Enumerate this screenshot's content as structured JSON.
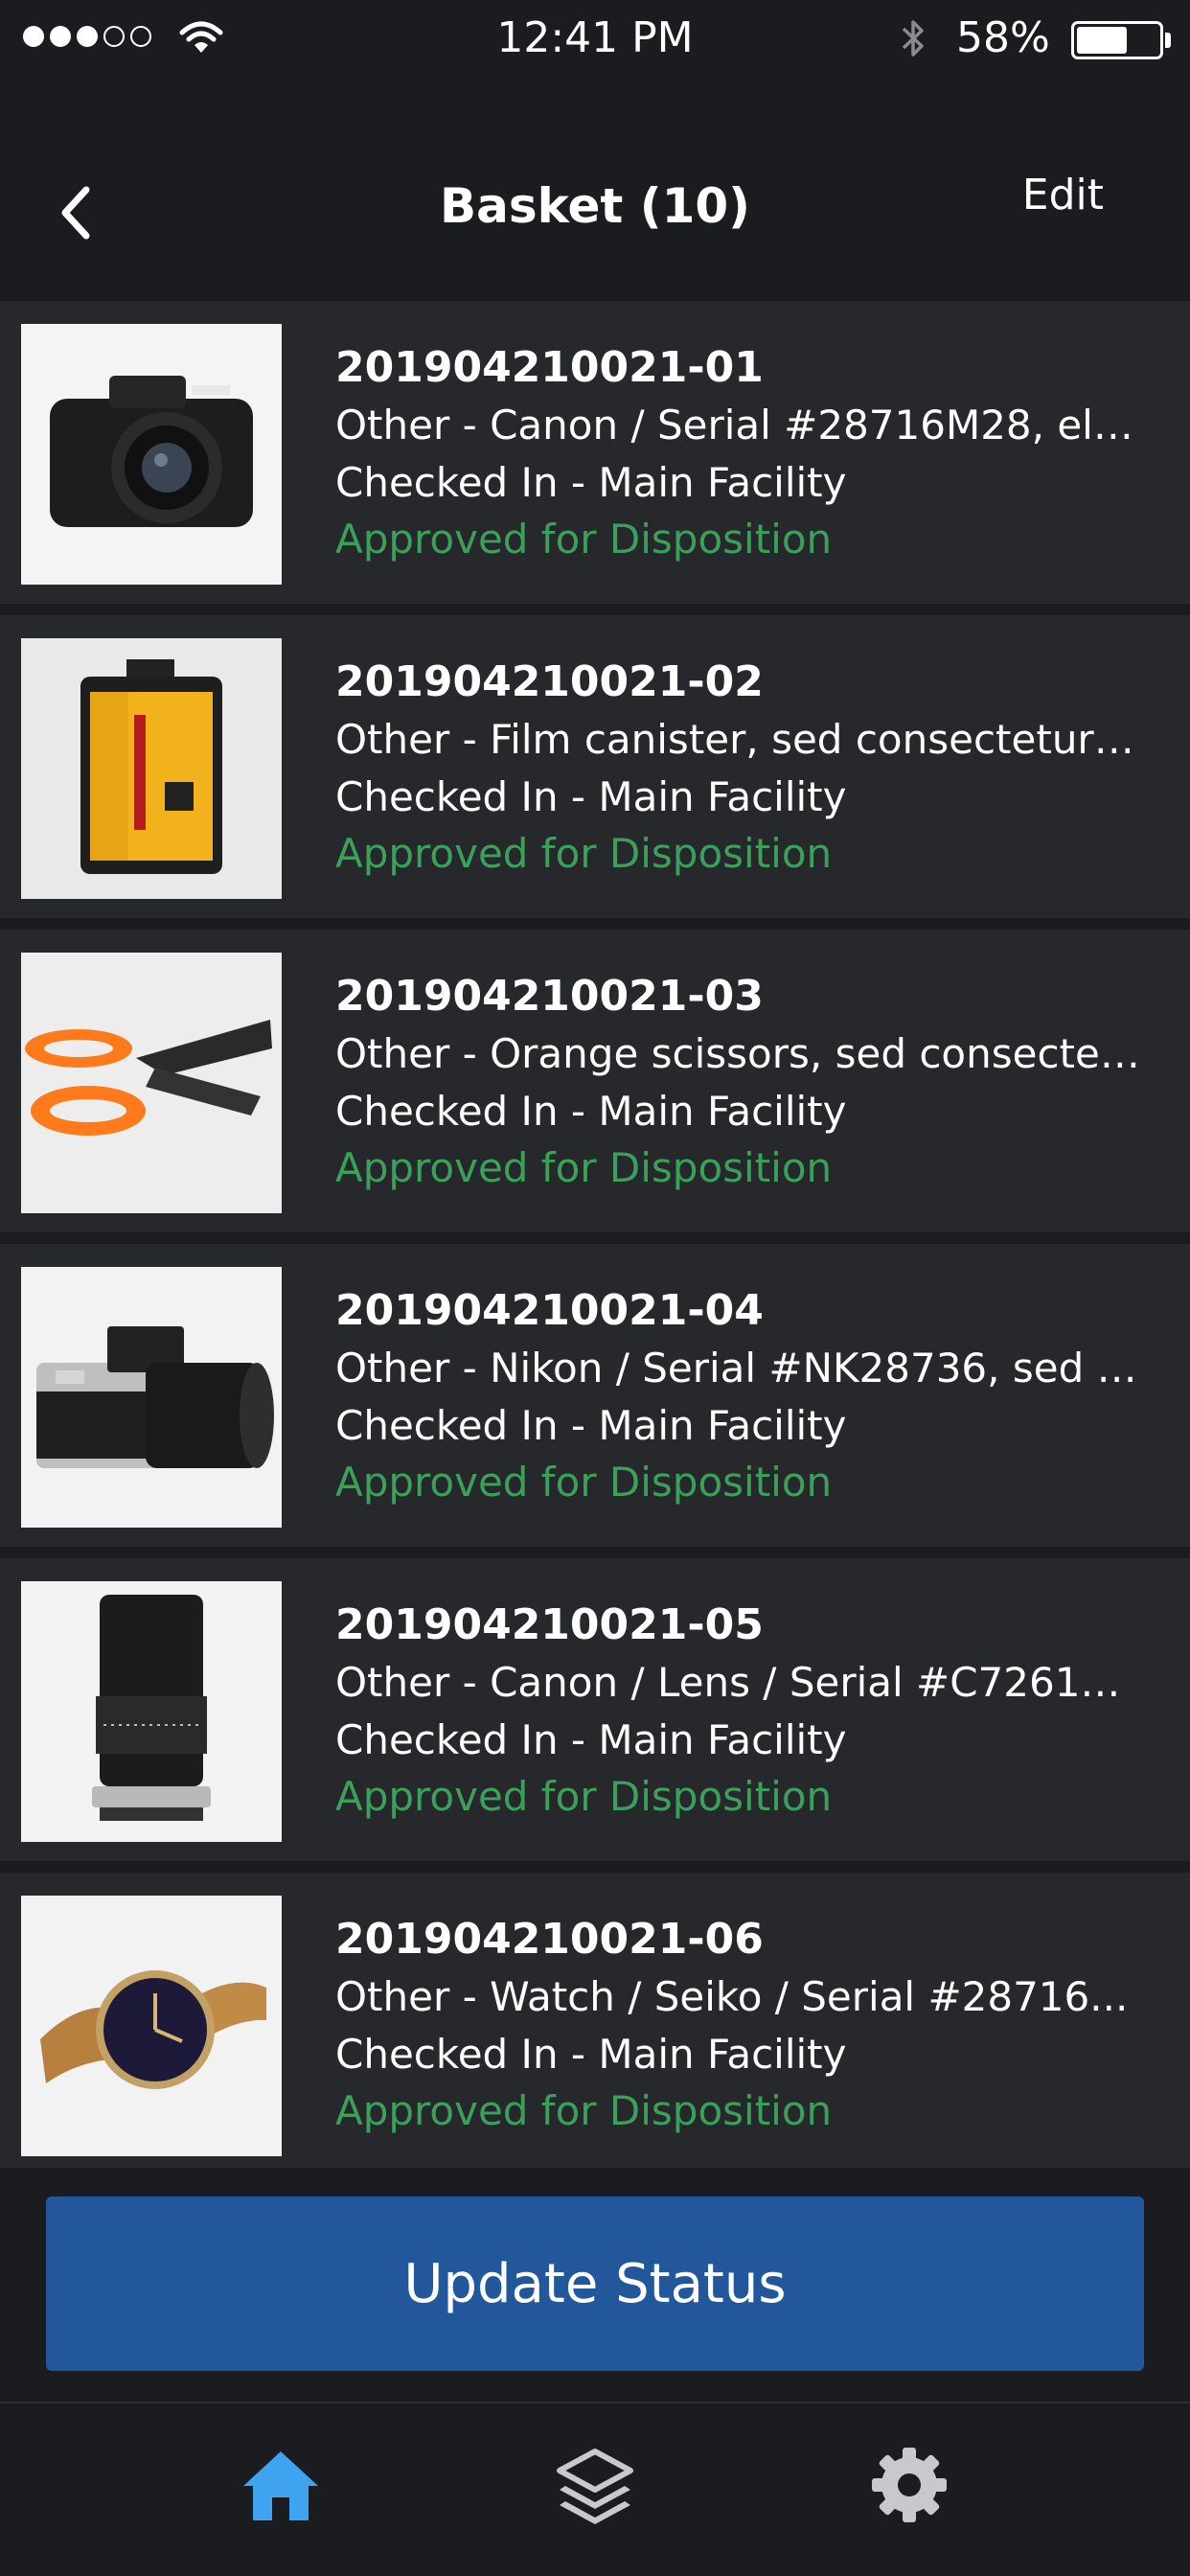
{
  "status_bar": {
    "signal_dots_full": 3,
    "signal_dots_total": 5,
    "time": "12:41 PM",
    "battery_percent": "58%",
    "battery_level": 0.58
  },
  "nav": {
    "title": "Basket (10)",
    "edit_label": "Edit"
  },
  "items": [
    {
      "id": "201904210021-01",
      "description": "Other - Canon / Serial #28716M28, elli...",
      "location": "Checked In - Main Facility",
      "status": "Approved for Disposition",
      "thumbnail_icon": "canon-camera-photo"
    },
    {
      "id": "201904210021-02",
      "description": "Other - Film canister, sed consectetur ...",
      "location": "Checked In - Main Facility",
      "status": "Approved for Disposition",
      "thumbnail_icon": "film-canister-photo"
    },
    {
      "id": "201904210021-03",
      "description": "Other - Orange scissors, sed consectet...",
      "location": "Checked In - Main Facility",
      "status": "Approved for Disposition",
      "thumbnail_icon": "scissors-photo"
    },
    {
      "id": "201904210021-04",
      "description": "Other - Nikon / Serial #NK28736, sed c...",
      "location": "Checked In - Main Facility",
      "status": "Approved for Disposition",
      "thumbnail_icon": "nikon-camera-photo"
    },
    {
      "id": "201904210021-05",
      "description": "Other - Canon / Lens / Serial #C72612...",
      "location": "Checked In - Main Facility",
      "status": "Approved for Disposition",
      "thumbnail_icon": "lens-photo"
    },
    {
      "id": "201904210021-06",
      "description": "Other - Watch / Seiko / Serial #28716...",
      "location": "Checked In - Main Facility",
      "status": "Approved for Disposition",
      "thumbnail_icon": "watch-photo"
    }
  ],
  "update_button_label": "Update Status",
  "tab_bar": {
    "tabs": [
      {
        "icon": "home-icon",
        "active": true
      },
      {
        "icon": "layers-icon",
        "active": false
      },
      {
        "icon": "gear-icon",
        "active": false
      }
    ]
  },
  "colors": {
    "background": "#1b1c1f",
    "row_background": "#26282c",
    "status_green": "#3aa05a",
    "button_blue": "#22579b",
    "active_tab": "#3fa3f0",
    "inactive_tab": "#c8c9cc"
  }
}
